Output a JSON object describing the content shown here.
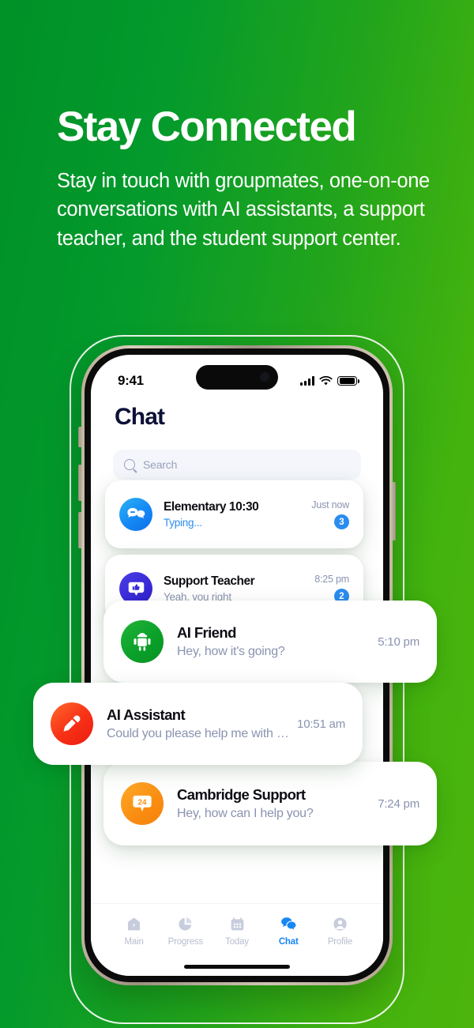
{
  "hero": {
    "title": "Stay Connected",
    "subtitle": "Stay in touch with groupmates, one-on-one conversations with AI assistants, a support teacher, and the student support center."
  },
  "colors": {
    "bg_green_start": "#009127",
    "bg_green_end": "#4cb40d",
    "accent_blue": "#2b8cf0",
    "title_navy": "#0d1037",
    "muted_text": "#8a93b0"
  },
  "phone": {
    "statusbar": {
      "time": "9:41",
      "signal_icon": "cellular-bars-icon",
      "wifi_icon": "wifi-icon",
      "battery_icon": "battery-icon"
    },
    "app": {
      "title": "Chat",
      "search": {
        "placeholder": "Search",
        "icon": "search-icon"
      },
      "chats": [
        {
          "name": "Elementary 10:30",
          "preview": "Typing...",
          "time": "Just now",
          "badge": "3",
          "avatar_icon": "group-chat-bubbles-icon",
          "avatar_color": "#1488f5"
        },
        {
          "name": "Support Teacher",
          "preview": "Yeah, you right",
          "time": "8:25 pm",
          "badge": "2",
          "avatar_icon": "thumbs-up-bubble-icon",
          "avatar_color": "#3a2ad8"
        },
        {
          "name": "AI Friend",
          "preview": "Hey, how it's going?",
          "time": "5:10 pm",
          "badge": "",
          "avatar_icon": "android-robot-icon",
          "avatar_color": "#0ba12a"
        },
        {
          "name": "AI Assistant",
          "preview": "Could you please help me with essay s...",
          "time": "10:51 am",
          "badge": "",
          "avatar_icon": "pen-icon",
          "avatar_color": "#f83317"
        },
        {
          "name": "Cambridge Support",
          "preview": "Hey, how can I help you?",
          "time": "7:24 pm",
          "badge": "",
          "avatar_icon": "twentyfour-bubble-icon",
          "avatar_color": "#fa8f12"
        }
      ],
      "tabs": [
        {
          "label": "Main",
          "icon": "home-icon",
          "active": false
        },
        {
          "label": "Progress",
          "icon": "pie-chart-icon",
          "active": false
        },
        {
          "label": "Today",
          "icon": "calendar-icon",
          "active": false
        },
        {
          "label": "Chat",
          "icon": "chat-icon",
          "active": true
        },
        {
          "label": "Profile",
          "icon": "person-icon",
          "active": false
        }
      ]
    }
  }
}
